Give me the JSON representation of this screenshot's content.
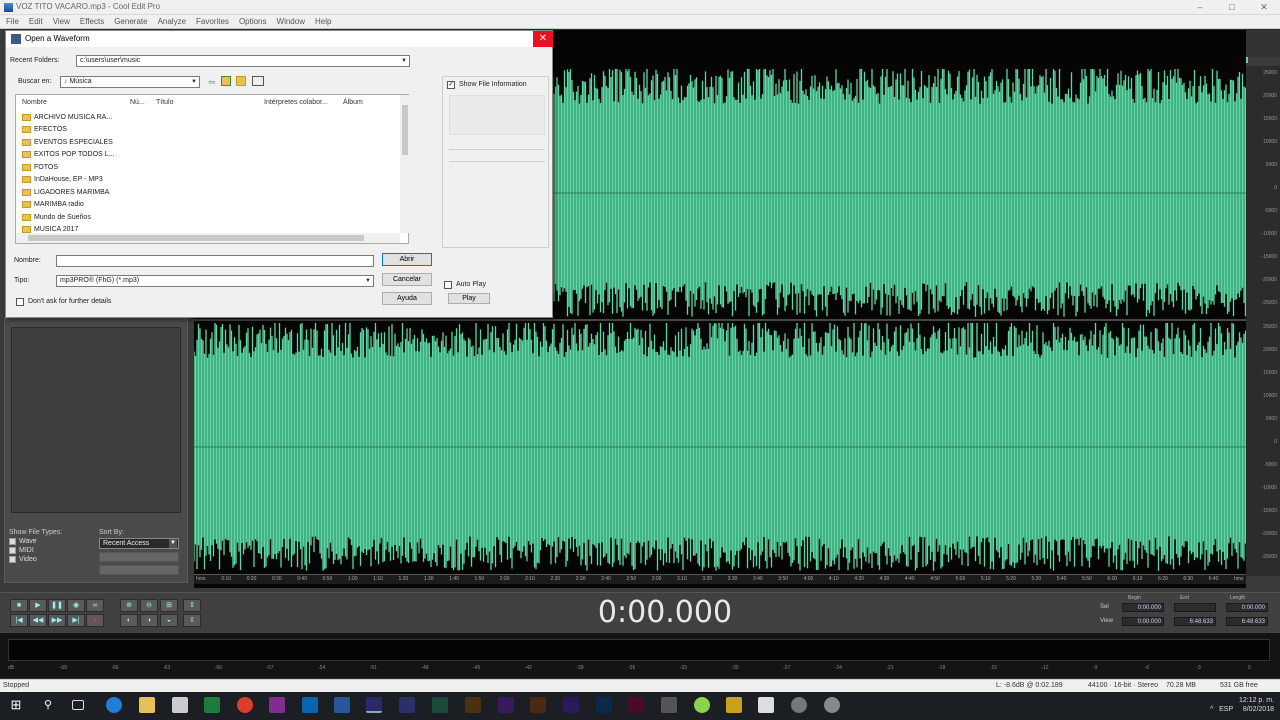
{
  "window": {
    "title": "VOZ TITO VACARO.mp3 - Cool Edit Pro",
    "buttons": [
      "–",
      "□",
      "✕"
    ]
  },
  "menu": [
    "File",
    "Edit",
    "View",
    "Effects",
    "Generate",
    "Analyze",
    "Favorites",
    "Options",
    "Window",
    "Help"
  ],
  "organizer": {
    "show_file_types_label": "Show File Types:",
    "file_types": [
      "Wave",
      "MIDI",
      "Video"
    ],
    "sort_by_label": "Sort By:",
    "sort_by_value": "Recent Access"
  },
  "waveform": {
    "color": "#5ad9a4",
    "amplitude_labels": [
      "25000",
      "20000",
      "15000",
      "10000",
      "5000",
      "0",
      "-5000",
      "-10000",
      "-15000",
      "-20000",
      "-25000"
    ],
    "time_labels": [
      "hms",
      "0:10",
      "0:20",
      "0:30",
      "0:40",
      "0:50",
      "1:00",
      "1:10",
      "1:20",
      "1:30",
      "1:40",
      "1:50",
      "2:00",
      "2:10",
      "2:20",
      "2:30",
      "2:40",
      "2:50",
      "3:00",
      "3:10",
      "3:20",
      "3:30",
      "3:40",
      "3:50",
      "4:00",
      "4:10",
      "4:20",
      "4:30",
      "4:40",
      "4:50",
      "5:00",
      "5:10",
      "5:20",
      "5:30",
      "5:40",
      "5:50",
      "6:00",
      "6:10",
      "6:20",
      "6:30",
      "6:40",
      "hms"
    ]
  },
  "transport": {
    "time": "0:00.000",
    "selection": {
      "headers": [
        "Begin",
        "End",
        "Length"
      ],
      "rows": [
        {
          "label": "Sel",
          "values": [
            "0:00.000",
            "",
            "0:00.000"
          ]
        },
        {
          "label": "View",
          "values": [
            "0:00.000",
            "6:48.633",
            "6:48.633"
          ]
        }
      ]
    }
  },
  "meter": {
    "scale": [
      "dB",
      "-69",
      "-66",
      "-63",
      "-60",
      "-57",
      "-54",
      "-51",
      "-48",
      "-45",
      "-42",
      "-39",
      "-36",
      "-33",
      "-30",
      "-27",
      "-24",
      "-21",
      "-18",
      "-15",
      "-12",
      "-9",
      "-6",
      "-3",
      "0"
    ]
  },
  "status": {
    "left": "Stopped",
    "items": [
      "L: -8.6dB @ 0:02.189",
      "44100 · 16-bit · Stereo",
      "70.28 MB",
      "531 GB free"
    ]
  },
  "taskbar": {
    "time": "12:12 p. m.",
    "date": "8/02/2018",
    "tray": [
      "^",
      "ESP"
    ]
  },
  "dialog": {
    "title": "Open a Waveform",
    "recent_folders_label": "Recent Folders:",
    "recent_folders_value": "c:\\users\\user\\music",
    "look_in_label": "Buscar en:",
    "look_in_value": "Música",
    "columns": [
      "Nombre",
      "Nú...",
      "Título",
      "Intérpretes colabor...",
      "Álbum"
    ],
    "folders": [
      "ARCHIVO MUSICA RA...",
      "EFECTOS",
      "EVENTOS ESPECIALES",
      "EXITOS POP TODOS L...",
      "FOTOS",
      "InDaHouse, EP - MP3",
      "LIGADORES MARIMBA",
      "MARIMBA radio",
      "Mundo de Sueños",
      "MUSICA 2017"
    ],
    "name_label": "Nombre:",
    "name_value": "",
    "type_label": "Tipo:",
    "type_value": "mp3PRO® (FhG) (*.mp3)",
    "open_button": "Abrir",
    "cancel_button": "Cancelar",
    "help_button": "Ayuda",
    "dont_ask_label": "Don't ask for further details",
    "show_file_info_label": "Show File Information",
    "auto_play_label": "Auto Play",
    "play_button": "Play"
  }
}
